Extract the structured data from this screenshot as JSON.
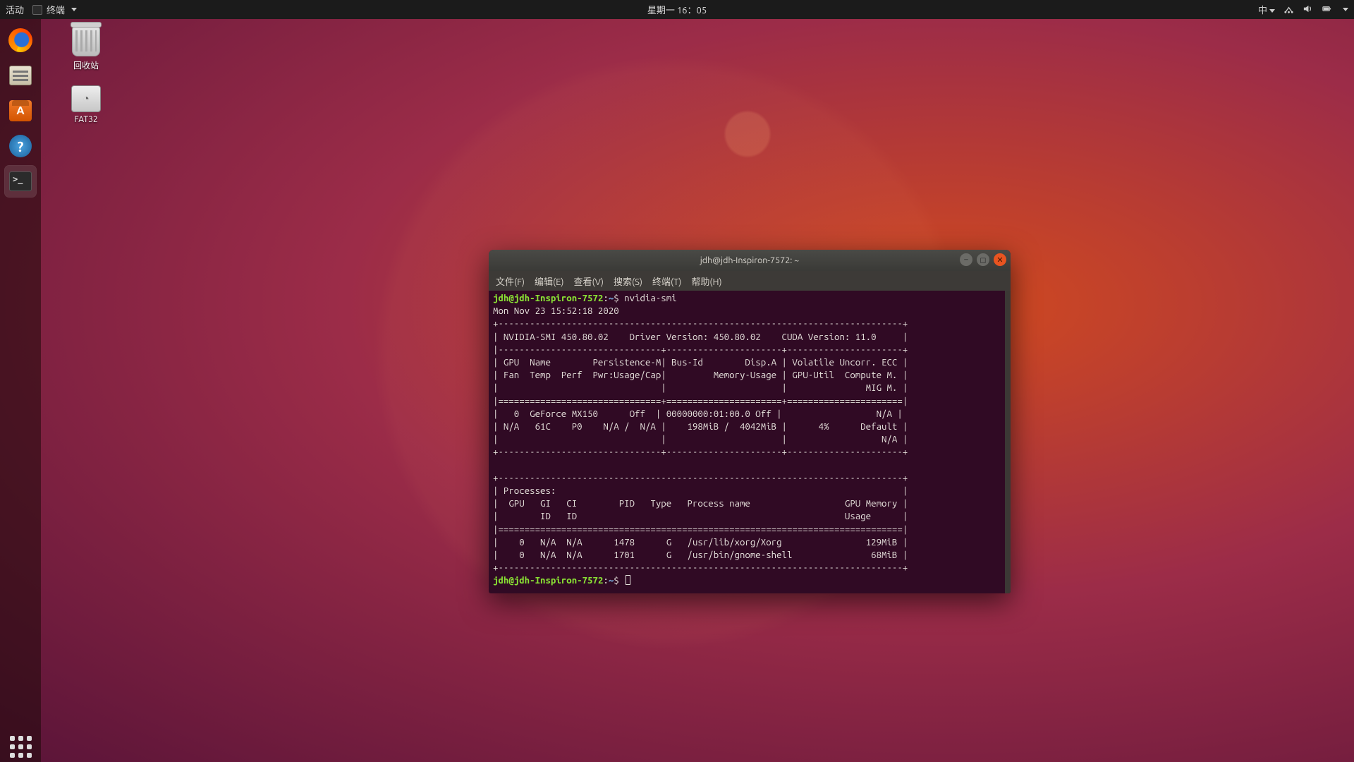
{
  "panel": {
    "activities": "活动",
    "app_indicator": "终端",
    "clock": "星期一 16：05",
    "input_method": "中",
    "tray": {
      "network": "network-icon",
      "volume": "volume-icon",
      "battery": "battery-icon",
      "caret": "▾"
    }
  },
  "dock": {
    "items": [
      {
        "name": "firefox",
        "label": "Firefox"
      },
      {
        "name": "files",
        "label": "Files"
      },
      {
        "name": "software",
        "label": "Ubuntu Software"
      },
      {
        "name": "help",
        "label": "Help"
      },
      {
        "name": "terminal",
        "label": "Terminal",
        "active": true
      }
    ],
    "apps_label": "Show Applications"
  },
  "desktop": {
    "icons": [
      {
        "name": "trash",
        "label": "回收站"
      },
      {
        "name": "disk-fat32",
        "label": "FAT32"
      }
    ]
  },
  "terminal": {
    "title": "jdh@jdh-Inspiron-7572: ~",
    "menu": [
      "文件(F)",
      "编辑(E)",
      "查看(V)",
      "搜索(S)",
      "终端(T)",
      "帮助(H)"
    ],
    "prompt_user": "jdh@jdh-Inspiron-7572",
    "prompt_path": "~",
    "command": "nvidia-smi",
    "timestamp_line": "Mon Nov 23 15:52:18 2020",
    "smi": {
      "version": "450.80.02",
      "driver_version": "450.80.02",
      "cuda_version": "11.0",
      "gpu": {
        "index": "0",
        "name": "GeForce MX150",
        "persistence": "Off",
        "bus_id": "00000000:01:00.0",
        "disp_a": "Off",
        "fan": "N/A",
        "temp": "61C",
        "perf": "P0",
        "pwr_usage": "N/A",
        "pwr_cap": "N/A",
        "mem_used": "198MiB",
        "mem_total": "4042MiB",
        "gpu_util": "4%",
        "compute_mode": "Default",
        "ecc": "N/A",
        "mig": "N/A"
      },
      "processes": [
        {
          "gpu": "0",
          "gi": "N/A",
          "ci": "N/A",
          "pid": "1478",
          "type": "G",
          "name": "/usr/lib/xorg/Xorg",
          "mem": "129MiB"
        },
        {
          "gpu": "0",
          "gi": "N/A",
          "ci": "N/A",
          "pid": "1701",
          "type": "G",
          "name": "/usr/bin/gnome-shell",
          "mem": "68MiB"
        }
      ]
    },
    "output_lines": [
      "+-----------------------------------------------------------------------------+",
      "| NVIDIA-SMI 450.80.02    Driver Version: 450.80.02    CUDA Version: 11.0     |",
      "|-------------------------------+----------------------+----------------------+",
      "| GPU  Name        Persistence-M| Bus-Id        Disp.A | Volatile Uncorr. ECC |",
      "| Fan  Temp  Perf  Pwr:Usage/Cap|         Memory-Usage | GPU-Util  Compute M. |",
      "|                               |                      |               MIG M. |",
      "|===============================+======================+======================|",
      "|   0  GeForce MX150      Off  | 00000000:01:00.0 Off |                  N/A |",
      "| N/A   61C    P0    N/A /  N/A |    198MiB /  4042MiB |      4%      Default |",
      "|                               |                      |                  N/A |",
      "+-------------------------------+----------------------+----------------------+",
      "",
      "+-----------------------------------------------------------------------------+",
      "| Processes:                                                                  |",
      "|  GPU   GI   CI        PID   Type   Process name                  GPU Memory |",
      "|        ID   ID                                                   Usage      |",
      "|=============================================================================|",
      "|    0   N/A  N/A      1478      G   /usr/lib/xorg/Xorg                129MiB |",
      "|    0   N/A  N/A      1701      G   /usr/bin/gnome-shell               68MiB |",
      "+-----------------------------------------------------------------------------+"
    ]
  }
}
